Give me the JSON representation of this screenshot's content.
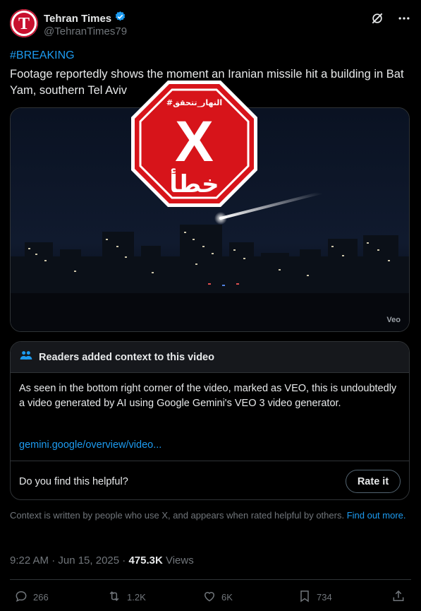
{
  "author": {
    "name": "Tehran Times",
    "handle": "@TehranTimes79",
    "avatar_letter": "T",
    "verified": true
  },
  "header_icons": [
    "grok-icon",
    "more-icon"
  ],
  "tweet": {
    "hashtag": "#BREAKING",
    "text": "Footage reportedly shows the moment an Iranian missile hit a building in Bat Yam, southern Tel Aviv"
  },
  "media": {
    "watermark": "Veo",
    "overlay": {
      "tag": "#النهار_تتحقق",
      "mark": "X",
      "verdict": "خطأ"
    }
  },
  "community_note": {
    "title": "Readers added context to this video",
    "body": "As seen in the bottom right corner of the video, marked as VEO, this is undoubtedly a video generated by AI using Google Gemini's VEO 3 video generator.",
    "link": "gemini.google/overview/video...",
    "question": "Do you find this helpful?",
    "rate_label": "Rate it"
  },
  "context_footer": {
    "text": "Context is written by people who use X, and appears when rated helpful by others.",
    "link": "Find out more."
  },
  "meta": {
    "time": "9:22 AM · Jun 15, 2025 · ",
    "views_count": "475.3K",
    "views_label": " Views"
  },
  "actions": {
    "replies": "266",
    "reposts": "1.2K",
    "likes": "6K",
    "bookmarks": "734"
  },
  "colors": {
    "accent": "#1d9bf0",
    "stop_red": "#d7141a",
    "background": "#000000"
  }
}
